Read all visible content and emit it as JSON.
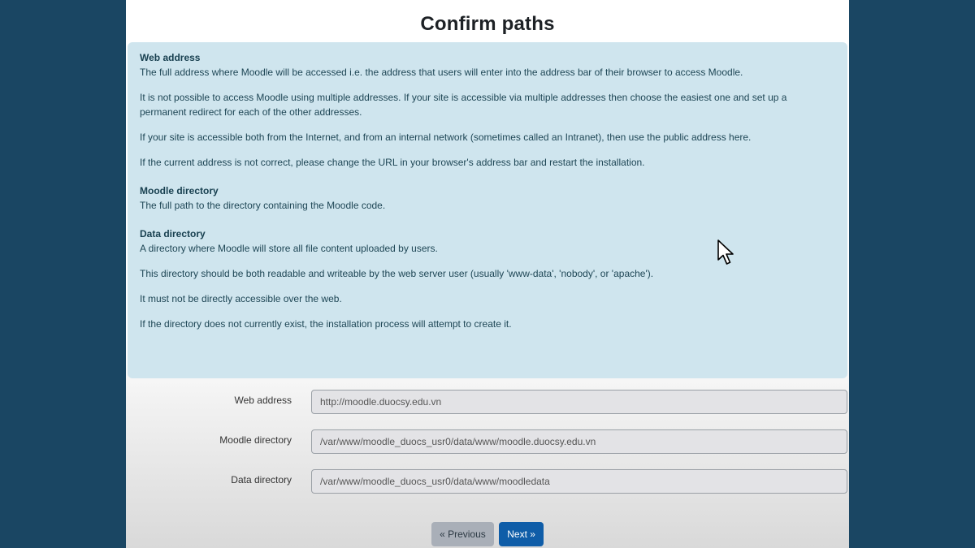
{
  "page": {
    "title": "Confirm paths"
  },
  "info": {
    "web_address": {
      "heading": "Web address",
      "paragraphs": [
        "The full address where Moodle will be accessed i.e. the address that users will enter into the address bar of their browser to access Moodle.",
        "It is not possible to access Moodle using multiple addresses. If your site is accessible via multiple addresses then choose the easiest one and set up a permanent redirect for each of the other addresses.",
        "If your site is accessible both from the Internet, and from an internal network (sometimes called an Intranet), then use the public address here.",
        "If the current address is not correct, please change the URL in your browser's address bar and restart the installation."
      ]
    },
    "moodle_directory": {
      "heading": "Moodle directory",
      "paragraphs": [
        "The full path to the directory containing the Moodle code."
      ]
    },
    "data_directory": {
      "heading": "Data directory",
      "paragraphs": [
        "A directory where Moodle will store all file content uploaded by users.",
        "This directory should be both readable and writeable by the web server user (usually 'www-data', 'nobody', or 'apache').",
        "It must not be directly accessible over the web.",
        "If the directory does not currently exist, the installation process will attempt to create it."
      ]
    }
  },
  "form": {
    "web_address": {
      "label": "Web address",
      "value": "http://moodle.duocsy.edu.vn"
    },
    "moodle_directory": {
      "label": "Moodle directory",
      "value": "/var/www/moodle_duocs_usr0/data/www/moodle.duocsy.edu.vn"
    },
    "data_directory": {
      "label": "Data directory",
      "value": "/var/www/moodle_duocs_usr0/data/www/moodledata"
    }
  },
  "buttons": {
    "previous": "« Previous",
    "next": "Next »"
  },
  "colors": {
    "background": "#1a4663",
    "info_box": "#cfe5ee",
    "primary_button": "#0f5da8",
    "secondary_button": "#a9afb8"
  },
  "icons": {
    "cursor": "mouse-pointer-icon"
  }
}
